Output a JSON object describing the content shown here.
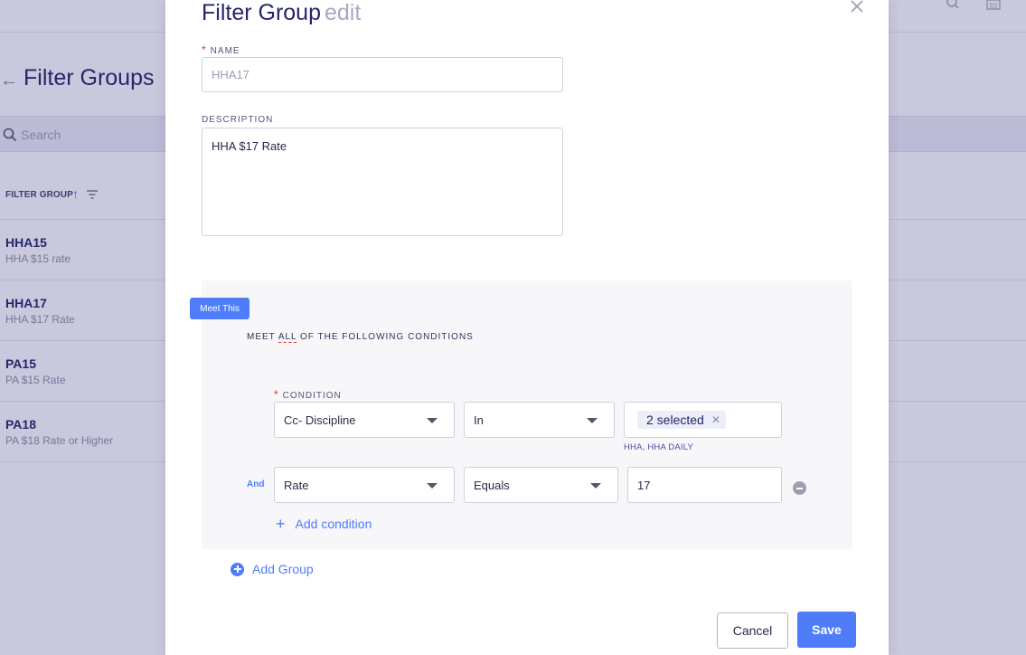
{
  "background": {
    "page_title": "Filter Groups",
    "search_placeholder": "Search",
    "table": {
      "column_header": "FILTER GROUP",
      "rows": [
        {
          "name": "HHA15",
          "description": "HHA $15 rate"
        },
        {
          "name": "HHA17",
          "description": "HHA $17 Rate"
        },
        {
          "name": "PA15",
          "description": "PA $15 Rate"
        },
        {
          "name": "PA18",
          "description": "PA $18 Rate or Higher"
        }
      ]
    },
    "icons": [
      "back-arrow-icon",
      "search-icon",
      "sort-ascending-icon",
      "filter-icon"
    ]
  },
  "modal": {
    "title": "Filter Group",
    "title_mode": "edit",
    "name": {
      "label": "NAME",
      "placeholder": "HHA17"
    },
    "description": {
      "label": "DESCRIPTION",
      "value": "HHA $17 Rate"
    },
    "group": {
      "badge": "Meet This",
      "meet_prefix": "MEET ",
      "meet_operator": "ALL",
      "meet_suffix": " OF THE FOLLOWING CONDITIONS",
      "condition_label": "CONDITION",
      "conditions": [
        {
          "field": "Cc- Discipline",
          "operator": "In",
          "value_tag": "2 selected",
          "value_hint": "HHA, HHA DAILY"
        },
        {
          "connector": "And",
          "field": "Rate",
          "operator": "Equals",
          "value": "17"
        }
      ],
      "add_condition": "Add condition"
    },
    "add_group": "Add Group",
    "buttons": {
      "cancel": "Cancel",
      "save": "Save"
    }
  },
  "colors": {
    "accent": "#4f7dfa",
    "title": "#26266a",
    "required": "#e0313a"
  }
}
